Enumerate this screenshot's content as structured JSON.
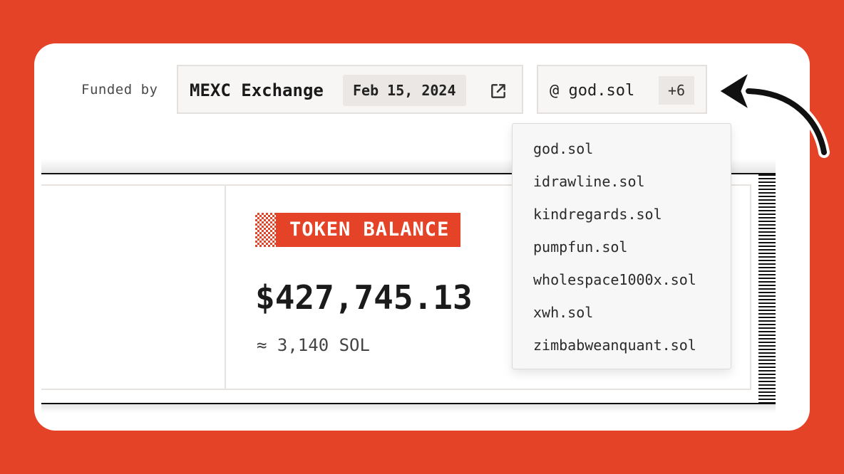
{
  "funding": {
    "label": "Funded by",
    "source": "MEXC Exchange",
    "date": "Feb 15, 2024"
  },
  "identity": {
    "primary": "@ god.sol",
    "extra_count": "+6"
  },
  "dropdown": {
    "items": [
      "god.sol",
      "idrawline.sol",
      "kindregards.sol",
      "pumpfun.sol",
      "wholespace1000x.sol",
      "xwh.sol",
      "zimbabweanquant.sol"
    ]
  },
  "balance": {
    "badge": "TOKEN BALANCE",
    "value": "$427,745.13",
    "sol": "≈ 3,140 SOL"
  },
  "colors": {
    "background": "#e44327",
    "accent": "#e44327",
    "card": "#ffffff"
  },
  "icons": {
    "external": "external-link-icon",
    "arrow": "curved-arrow-icon"
  }
}
